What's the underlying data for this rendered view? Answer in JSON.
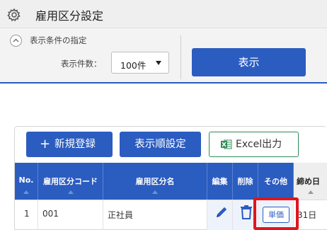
{
  "header": {
    "title": "雇用区分設定",
    "icon": "gear-icon"
  },
  "conditions": {
    "section_label": "表示条件の指定",
    "count_label": "表示件数：",
    "count_value": "100件",
    "show_button": "表示"
  },
  "toolbar": {
    "new_button": "新規登録",
    "new_icon": "+",
    "order_button": "表示順設定",
    "excel_button": "Excel出力"
  },
  "table": {
    "columns": [
      "No.",
      "雇用区分コード",
      "雇用区分名",
      "編集",
      "削除",
      "その他",
      "締め日"
    ],
    "rows": [
      {
        "no": "1",
        "code": "001",
        "name": "正社員",
        "other_button": "単価",
        "closing": "31日"
      }
    ]
  },
  "colors": {
    "accent": "#2b5cc0",
    "highlight": "#e0141e",
    "excel": "#2e8b57"
  }
}
